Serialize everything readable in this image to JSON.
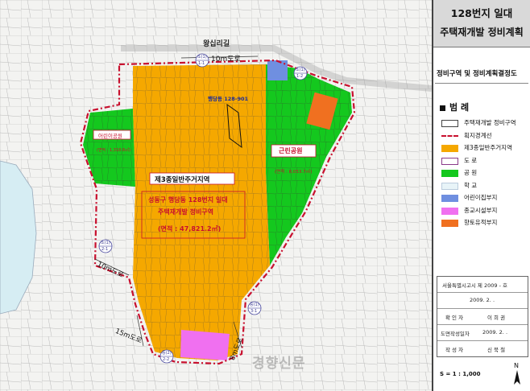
{
  "sidebar": {
    "title_line1": "128번지 일대",
    "title_line2": "주택재개발 정비계획",
    "subtitle": "정비구역 및 정비계획결정도",
    "legend_title": "범 례",
    "legend": [
      {
        "label": "주택재개발 정비구역",
        "color": "#ffffff",
        "style": "outline"
      },
      {
        "label": "획지경계선",
        "color": "#c8102e",
        "style": "dash"
      },
      {
        "label": "제3종일반주거지역",
        "color": "#f5a800",
        "style": "fill"
      },
      {
        "label": "도 로",
        "color": "#8a3a8a",
        "style": "road"
      },
      {
        "label": "공 원",
        "color": "#14c81e",
        "style": "fill"
      },
      {
        "label": "학 교",
        "color": "#e8f4f8",
        "style": "fill"
      },
      {
        "label": "어린이집부지",
        "color": "#6f8fe0",
        "style": "fill"
      },
      {
        "label": "종교시설부지",
        "color": "#f070f0",
        "style": "fill"
      },
      {
        "label": "향토유적부지",
        "color": "#f07020",
        "style": "fill"
      }
    ],
    "notice": {
      "line1": "서울특별시고시 제 2009 -      호",
      "line2": "2009.  2.   .",
      "rows": [
        {
          "key": "확 인 자",
          "value": "이 희 권"
        },
        {
          "key": "도면작성일자",
          "value": "2009.  2.   ."
        },
        {
          "key": "작 성 자",
          "value": "신 북 철"
        }
      ]
    },
    "scale": "S = 1 : 1,000",
    "north": "N"
  },
  "map": {
    "street_name": "왕십리길",
    "road_10m_top": "10m도로",
    "road_10m_left": "10m도로",
    "road_15m": "15m도로",
    "road_8m": "8m도로",
    "marker_top_left": {
      "top": "소(1)",
      "bottom": "1-1"
    },
    "marker_top_right": {
      "top": "소(1)",
      "bottom": "1-2"
    },
    "marker_left": {
      "top": "소(1)",
      "bottom": "2-1"
    },
    "marker_bottom": {
      "top": "중(2)",
      "bottom": "2-2"
    },
    "marker_right": {
      "top": "중(1)",
      "bottom": "3-1"
    },
    "parcel_label": "행당동 128-901",
    "zone_label": "제3종일반주거지역",
    "project_line1": "성동구 행당동 128번지 일대",
    "project_line2": "주택재개발 정비구역",
    "project_area": "(면적 : 47,821.2㎡)",
    "park_left_name": "어린이공원",
    "park_left_area": "(면적 : 1,318.8㎡)",
    "park_right_name": "근린공원",
    "park_right_area": "(면적 : 8,053.7㎡)",
    "watermark": "경향신문"
  },
  "colors": {
    "residential": "#f5a800",
    "park": "#14c81e",
    "boundary": "#c8102e",
    "daycare": "#6f8fe0",
    "religious": "#f070f0",
    "heritage": "#f07020",
    "water": "#d6edf3"
  }
}
